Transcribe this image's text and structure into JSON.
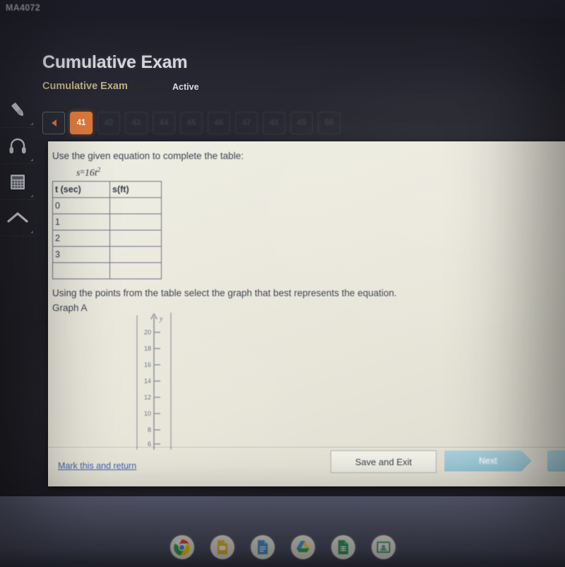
{
  "window": {
    "tab_label": "MA4072"
  },
  "header": {
    "title": "Cumulative Exam",
    "subtitle": "Cumulative Exam",
    "status": "Active",
    "accent_orange": "#e07b3c",
    "subtitle_color": "#c9bd8f"
  },
  "pager": {
    "prev_icon": "caret-left-icon",
    "current": "41",
    "items": [
      "42",
      "43",
      "44",
      "45",
      "46",
      "47",
      "48",
      "49",
      "50"
    ]
  },
  "rail": {
    "items": [
      {
        "name": "highlighter-icon",
        "label": "Highlighter"
      },
      {
        "name": "headphones-icon",
        "label": "Text to speech"
      },
      {
        "name": "calculator-icon",
        "label": "Calculator"
      },
      {
        "name": "collapse-up-icon",
        "label": "Collapse"
      }
    ]
  },
  "question": {
    "prompt": "Use the given equation to complete the table:",
    "equation_lhs": "s",
    "equation_eq": "=",
    "equation_rhs_coeff": "16",
    "equation_rhs_var": "t",
    "equation_rhs_exp": "2",
    "table": {
      "headers": [
        "t (sec)",
        "s(ft)"
      ],
      "rows": [
        [
          "0",
          ""
        ],
        [
          "1",
          ""
        ],
        [
          "2",
          ""
        ],
        [
          "3",
          ""
        ],
        [
          "",
          ""
        ]
      ]
    },
    "prompt2": "Using the points from the table select the graph that best represents the equation.",
    "graph_label": "Graph A"
  },
  "chart_data": {
    "type": "line",
    "title": "Graph A",
    "xlabel": "",
    "ylabel": "y",
    "axis_label": "y",
    "y_ticks": [
      20,
      18,
      16,
      14,
      12,
      10,
      8,
      6
    ],
    "ylim": [
      6,
      21
    ],
    "grid": false,
    "legend": "none",
    "note": "Only a narrow vertical strip of the y-axis is visible in the cropped image; tick labels 6 through 20 in steps of 2, arrow pointing up labeled y.",
    "series": []
  },
  "footer": {
    "mark_link": "Mark this and return",
    "save_label": "Save and Exit",
    "next_label": "Next"
  },
  "shelf": {
    "icons": [
      {
        "name": "chrome-icon",
        "label": "Chrome"
      },
      {
        "name": "google-slides-icon",
        "label": "Slides"
      },
      {
        "name": "google-docs-icon",
        "label": "Docs"
      },
      {
        "name": "google-drive-icon",
        "label": "Drive"
      },
      {
        "name": "google-sheets-icon",
        "label": "Sheets"
      },
      {
        "name": "google-classroom-icon",
        "label": "Classroom"
      }
    ]
  }
}
